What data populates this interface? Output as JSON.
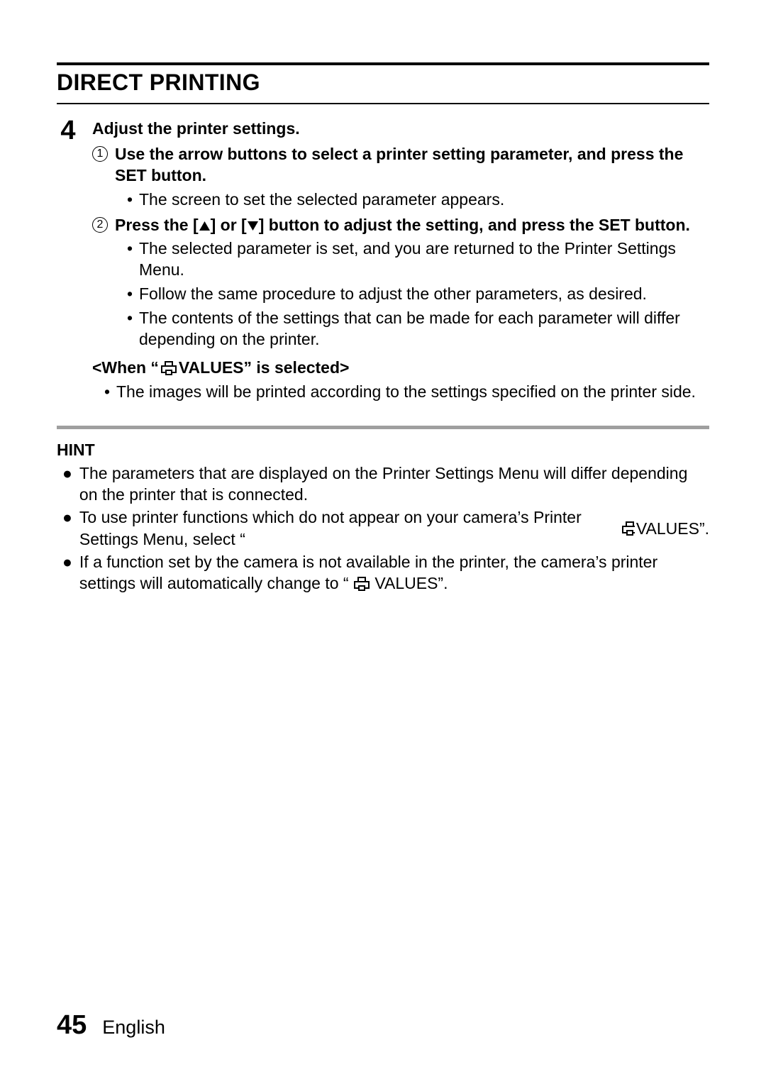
{
  "title": "DIRECT PRINTING",
  "step": {
    "number": "4",
    "heading": "Adjust the printer settings.",
    "sub1": {
      "num": "1",
      "text": "Use the arrow buttons to select a printer setting parameter, and press the SET button.",
      "bullets": [
        "The screen to set the selected parameter appears."
      ]
    },
    "sub2": {
      "num": "2",
      "text_before": "Press the [",
      "text_mid": "] or [",
      "text_after": "] button to adjust the setting, and press the SET button.",
      "bullets": [
        "The selected parameter is set, and you are returned to the Printer Settings Menu.",
        "Follow the same procedure to adjust the other parameters, as desired.",
        "The contents of the settings that can be made for each parameter will differ depending on the printer."
      ]
    },
    "when": {
      "before": "<When “",
      "after": " VALUES” is selected>",
      "bullets": [
        "The images will be printed according to the settings specified on the printer side."
      ]
    }
  },
  "hint": {
    "title": "HINT",
    "item1": "The parameters that are displayed on the Printer Settings Menu will differ depending on the printer that is connected.",
    "item2_before": "To use printer functions which do not appear on your camera’s Printer Settings Menu, select “",
    "item2_after": " VALUES”.",
    "item3_before": "If a function set by the camera is not available in the printer, the camera’s printer settings will automatically change to “",
    "item3_after": " VALUES”."
  },
  "footer": {
    "page": "45",
    "language": "English"
  }
}
